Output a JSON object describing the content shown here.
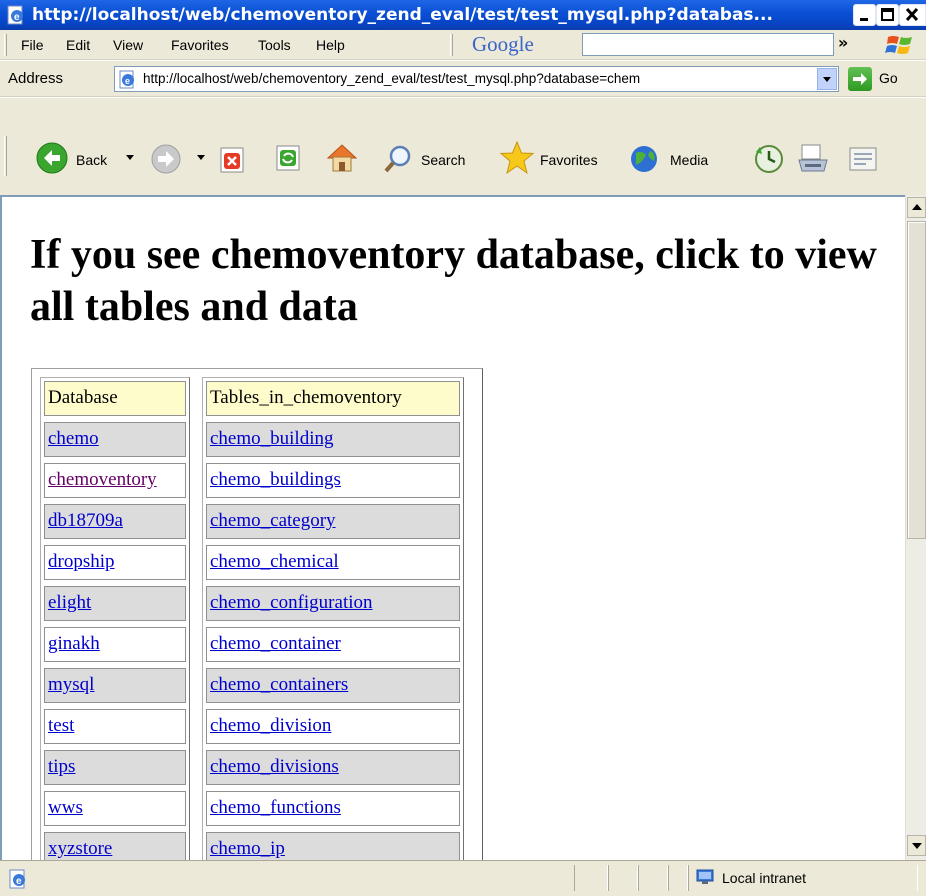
{
  "window": {
    "title": "http://localhost/web/chemoventory_zend_eval/test/test_mysql.php?databas..."
  },
  "menubar": {
    "items": [
      "File",
      "Edit",
      "View",
      "Favorites",
      "Tools",
      "Help"
    ],
    "google_logo": "Google",
    "google_search_value": "",
    "chevron": "»"
  },
  "address": {
    "label": "Address",
    "url": "http://localhost/web/chemoventory_zend_eval/test/test_mysql.php?database=chem",
    "go_label": "Go"
  },
  "toolbar": {
    "back_label": "Back",
    "search_label": "Search",
    "favorites_label": "Favorites",
    "media_label": "Media"
  },
  "page": {
    "heading": "If you see chemoventory database, click to view all tables and data",
    "databases": {
      "header": "Database",
      "items": [
        "chemo",
        "chemoventory",
        "db18709a",
        "dropship",
        "elight",
        "ginakh",
        "mysql",
        "test",
        "tips",
        "wws",
        "xyzstore"
      ],
      "visited": "chemoventory"
    },
    "tables": {
      "header": "Tables_in_chemoventory",
      "items": [
        "chemo_building",
        "chemo_buildings",
        "chemo_category",
        "chemo_chemical",
        "chemo_configuration",
        "chemo_container",
        "chemo_containers",
        "chemo_division",
        "chemo_divisions",
        "chemo_functions",
        "chemo_ip"
      ]
    }
  },
  "statusbar": {
    "status_text": "",
    "zone": "Local intranet"
  },
  "colors": {
    "link": "#0000cc",
    "visited_link": "#660066",
    "header_cell": "#fffccc",
    "alt_row": "#dcdcdc",
    "chrome": "#ece9d8",
    "title_bar": "#0a4fd3"
  }
}
